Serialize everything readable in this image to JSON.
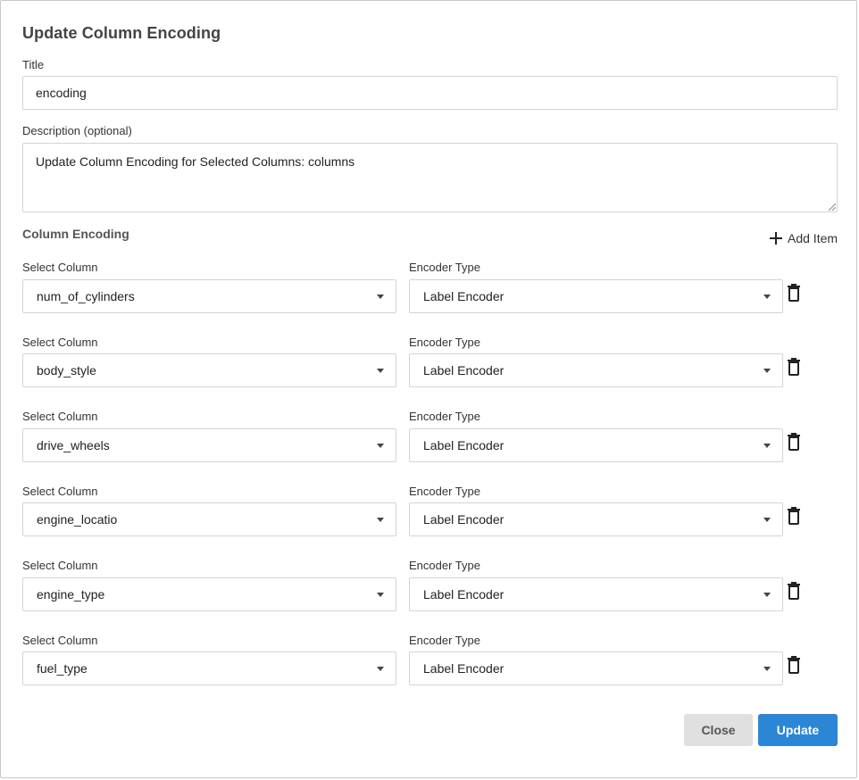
{
  "dialog": {
    "title": "Update Column Encoding",
    "title_label": "Title",
    "title_value": "encoding",
    "description_label": "Description (optional)",
    "description_value": "Update Column Encoding for Selected Columns: columns",
    "section_title": "Column Encoding",
    "add_item_label": "Add Item",
    "close_label": "Close",
    "update_label": "Update",
    "accent_color": "#2c86d6"
  },
  "rows": [
    {
      "column_label": "Select Column",
      "column_value": "num_of_cylinders",
      "encoder_label": "Encoder Type",
      "encoder_value": "Label Encoder"
    },
    {
      "column_label": "Select Column",
      "column_value": "body_style",
      "encoder_label": "Encoder Type",
      "encoder_value": "Label Encoder"
    },
    {
      "column_label": "Select Column",
      "column_value": "drive_wheels",
      "encoder_label": "Encoder Type",
      "encoder_value": "Label Encoder"
    },
    {
      "column_label": "Select Column",
      "column_value": "engine_locatio",
      "encoder_label": "Encoder Type",
      "encoder_value": "Label Encoder"
    },
    {
      "column_label": "Select Column",
      "column_value": "engine_type",
      "encoder_label": "Encoder Type",
      "encoder_value": "Label Encoder"
    },
    {
      "column_label": "Select Column",
      "column_value": "fuel_type",
      "encoder_label": "Encoder Type",
      "encoder_value": "Label Encoder"
    }
  ]
}
